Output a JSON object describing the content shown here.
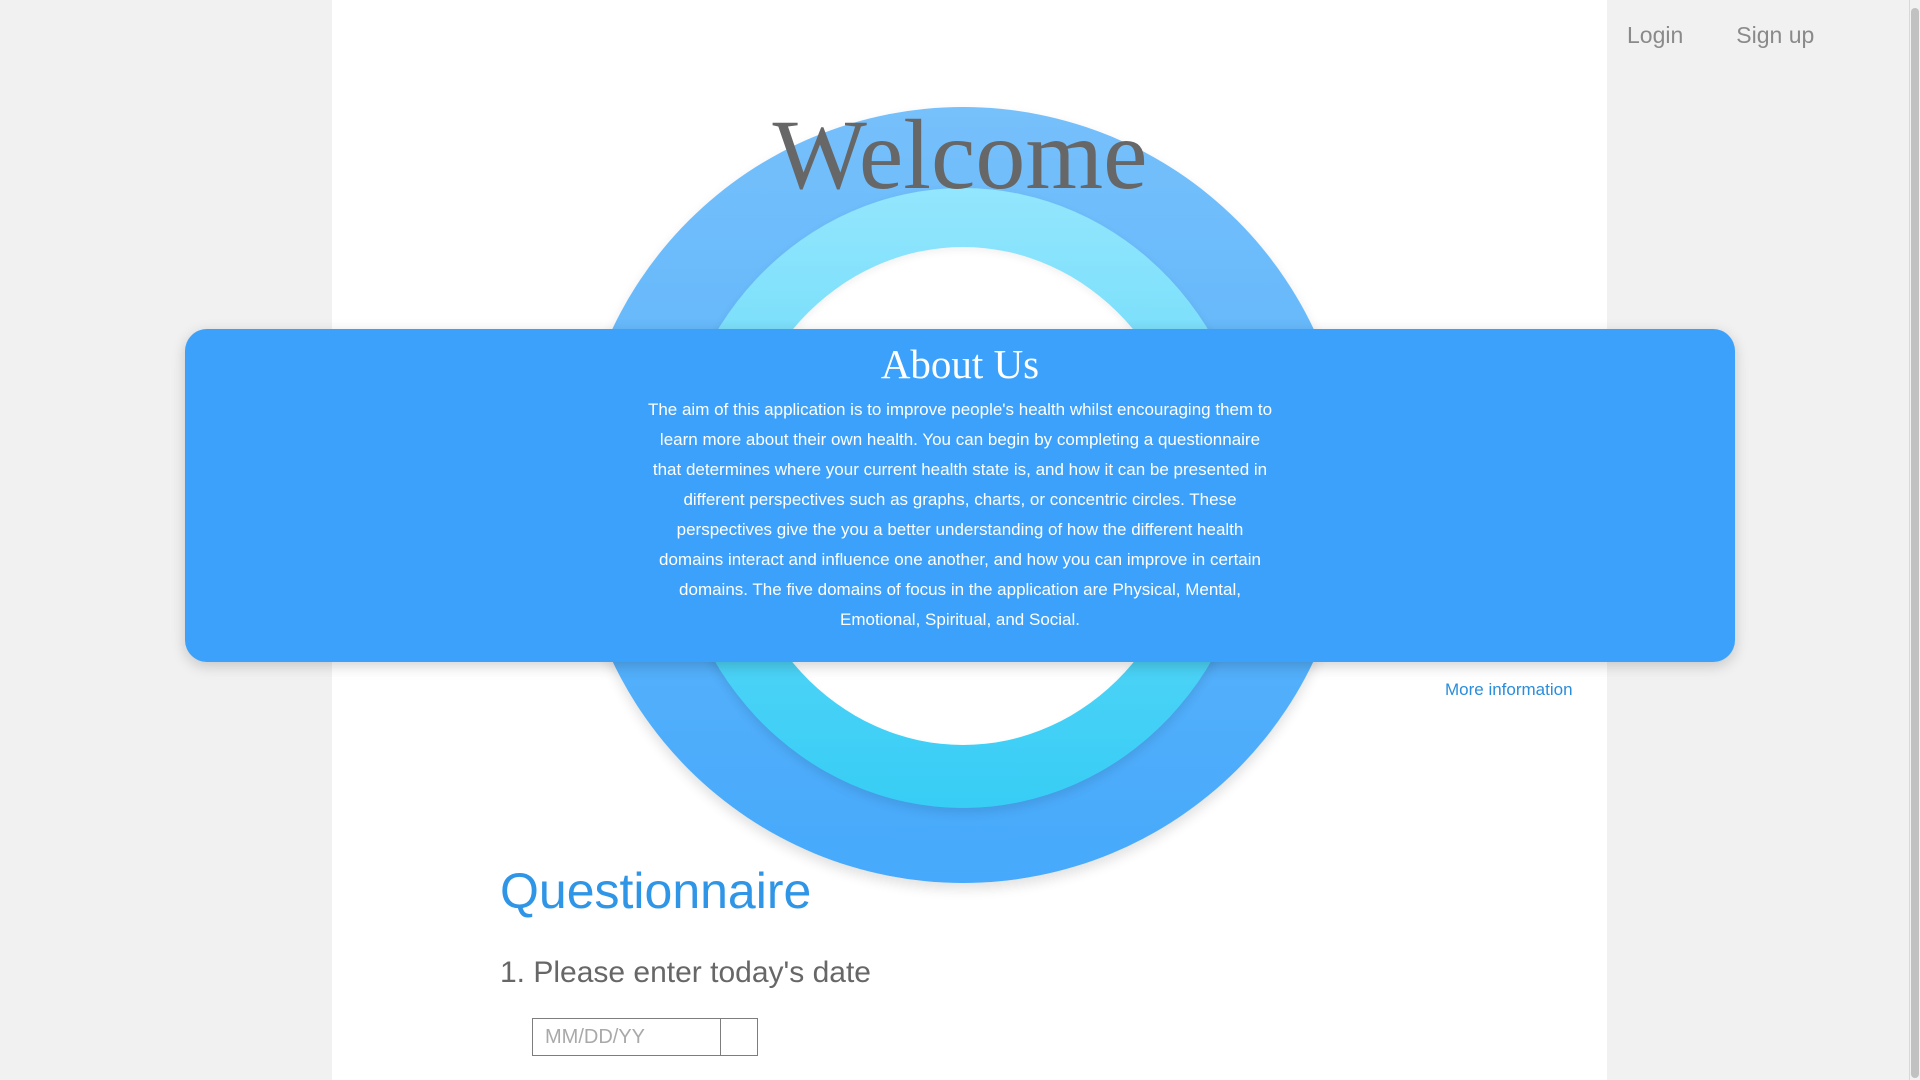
{
  "nav": {
    "login_label": "Login",
    "signup_label": "Sign up"
  },
  "hero": {
    "welcome": "Welcome"
  },
  "about": {
    "title": "About Us",
    "body": "The aim of this application is to improve people's health whilst encouraging them to learn more about their own health. You can begin by completing a questionnaire that determines where your current health state is, and how it can be presented in different perspectives such as graphs, charts, or concentric circles. These perspectives give the you a better understanding of how the different health domains interact and influence one another, and how you can improve in certain domains. The five domains of focus in the application are Physical, Mental, Emotional, Spiritual, and Social.",
    "more_link": "More information"
  },
  "questionnaire": {
    "title": "Questionnaire",
    "question1": "1. Please enter today's date",
    "date_placeholder": "MM/DD/YY"
  },
  "colors": {
    "accent": "#3ba1fb",
    "heading_blue": "#2f95e6",
    "text_gray": "#676767"
  }
}
